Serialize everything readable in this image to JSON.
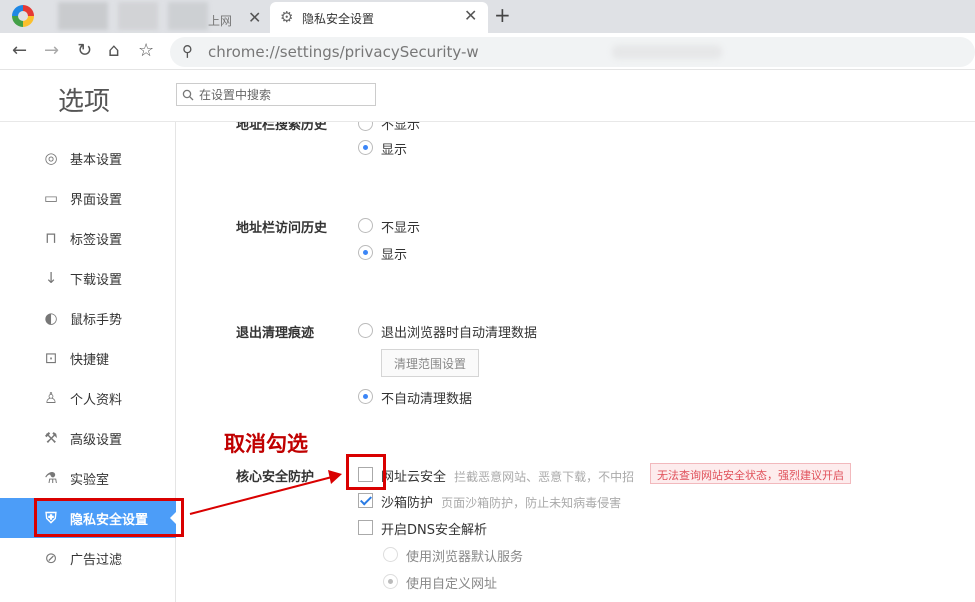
{
  "tabs": [
    {
      "title": "上网",
      "active": false
    },
    {
      "title": "隐私安全设置",
      "active": true
    }
  ],
  "toolbar": {
    "address": "chrome://settings/privacySecurity-w"
  },
  "header": {
    "title": "选项",
    "search_placeholder": "在设置中搜索"
  },
  "sidebar": {
    "items": [
      {
        "label": "基本设置",
        "icon": "gear-icon"
      },
      {
        "label": "界面设置",
        "icon": "window-icon"
      },
      {
        "label": "标签设置",
        "icon": "tab-icon"
      },
      {
        "label": "下载设置",
        "icon": "download-icon"
      },
      {
        "label": "鼠标手势",
        "icon": "mouse-icon"
      },
      {
        "label": "快捷键",
        "icon": "keyboard-icon"
      },
      {
        "label": "个人资料",
        "icon": "user-icon"
      },
      {
        "label": "高级设置",
        "icon": "wrench-icon"
      },
      {
        "label": "实验室",
        "icon": "flask-icon"
      },
      {
        "label": "隐私安全设置",
        "icon": "shield-icon",
        "active": true
      },
      {
        "label": "广告过滤",
        "icon": "block-icon"
      }
    ]
  },
  "content": {
    "section_addr_search": {
      "label": "地址栏搜索历史",
      "opt_hide": "不显示",
      "opt_show": "显示",
      "selected": "显示"
    },
    "section_addr_visit": {
      "label": "地址栏访问历史",
      "opt_hide": "不显示",
      "opt_show": "显示",
      "selected": "显示"
    },
    "section_clear": {
      "label": "退出清理痕迹",
      "opt_auto": "退出浏览器时自动清理数据",
      "range_button": "清理范围设置",
      "opt_no_auto": "不自动清理数据",
      "selected": "不自动清理数据"
    },
    "section_core": {
      "label": "核心安全防护",
      "url_cloud": {
        "label": "网址云安全",
        "hint": "拦截恶意网站、恶意下载，不中招",
        "checked": false
      },
      "warning": "无法查询网站安全状态，强烈建议开启",
      "sandbox": {
        "label": "沙箱防护",
        "hint": "页面沙箱防护，防止未知病毒侵害",
        "checked": true
      },
      "dns": {
        "label": "开启DNS安全解析",
        "checked": false
      },
      "dns_default": "使用浏览器默认服务",
      "dns_custom": "使用自定义网址",
      "dns_selected": "使用自定义网址"
    }
  },
  "annotation": {
    "text": "取消勾选",
    "color": "#c00000"
  },
  "colors": {
    "accent": "#4c9df8",
    "radio_on": "#3b86f7",
    "warning": "#e0505a"
  }
}
